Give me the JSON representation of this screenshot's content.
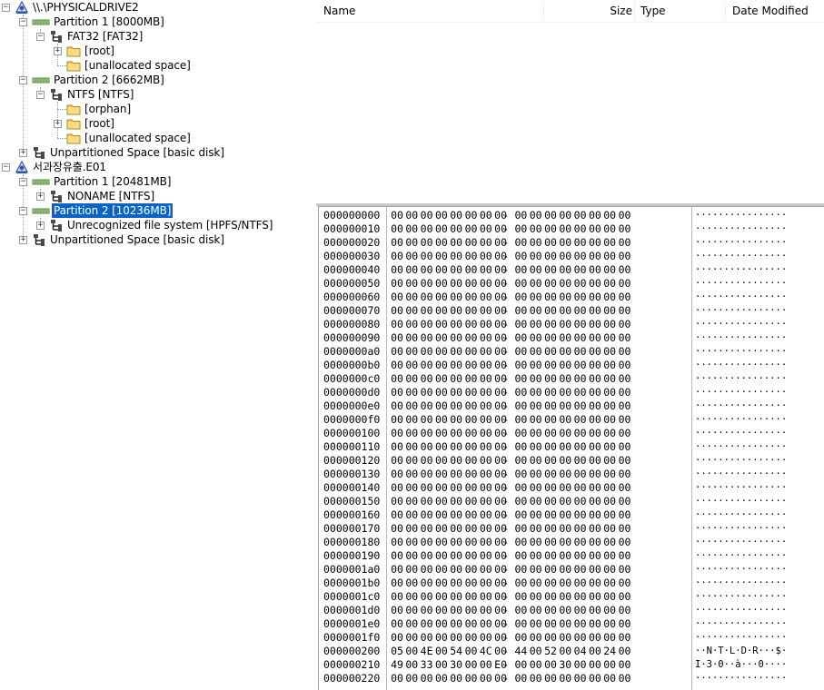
{
  "tree": {
    "nodes": [
      {
        "id": "drive2",
        "depth": 0,
        "label": "\\\\.\\PHYSICALDRIVE2",
        "icon": "disk-icon",
        "expander": "minus",
        "selected": false
      },
      {
        "id": "d2p1",
        "depth": 1,
        "label": "Partition 1 [8000MB]",
        "icon": "partition-icon",
        "expander": "minus",
        "selected": false
      },
      {
        "id": "d2p1fs",
        "depth": 2,
        "label": "FAT32 [FAT32]",
        "icon": "filesystem-icon",
        "expander": "minus",
        "selected": false
      },
      {
        "id": "d2p1root",
        "depth": 3,
        "label": "[root]",
        "icon": "folder-icon",
        "expander": "plus",
        "selected": false
      },
      {
        "id": "d2p1un",
        "depth": 3,
        "label": "[unallocated space]",
        "icon": "folder-icon",
        "expander": "none",
        "selected": false
      },
      {
        "id": "d2p2",
        "depth": 1,
        "label": "Partition 2 [6662MB]",
        "icon": "partition-icon",
        "expander": "minus",
        "selected": false
      },
      {
        "id": "d2p2fs",
        "depth": 2,
        "label": "NTFS [NTFS]",
        "icon": "filesystem-icon",
        "expander": "minus",
        "selected": false
      },
      {
        "id": "d2p2orphan",
        "depth": 3,
        "label": "[orphan]",
        "icon": "folder-icon",
        "expander": "none",
        "selected": false
      },
      {
        "id": "d2p2root",
        "depth": 3,
        "label": "[root]",
        "icon": "folder-icon",
        "expander": "plus",
        "selected": false
      },
      {
        "id": "d2p2un",
        "depth": 3,
        "label": "[unallocated space]",
        "icon": "folder-icon",
        "expander": "none",
        "selected": false
      },
      {
        "id": "d2unp",
        "depth": 1,
        "label": "Unpartitioned Space [basic disk]",
        "icon": "filesystem-icon",
        "expander": "plus",
        "selected": false
      },
      {
        "id": "e01",
        "depth": 0,
        "label": "서과장유출.E01",
        "icon": "disk-icon",
        "expander": "minus",
        "selected": false
      },
      {
        "id": "e01p1",
        "depth": 1,
        "label": "Partition 1 [20481MB]",
        "icon": "partition-icon",
        "expander": "minus",
        "selected": false
      },
      {
        "id": "e01p1fs",
        "depth": 2,
        "label": "NONAME [NTFS]",
        "icon": "filesystem-icon",
        "expander": "plus",
        "selected": false
      },
      {
        "id": "e01p2",
        "depth": 1,
        "label": "Partition 2 [10236MB]",
        "icon": "partition-icon",
        "expander": "minus",
        "selected": true
      },
      {
        "id": "e01p2fs",
        "depth": 2,
        "label": "Unrecognized file system [HPFS/NTFS]",
        "icon": "filesystem-icon",
        "expander": "plus",
        "selected": false
      },
      {
        "id": "e01unp",
        "depth": 1,
        "label": "Unpartitioned Space [basic disk]",
        "icon": "filesystem-icon",
        "expander": "plus",
        "selected": false
      }
    ]
  },
  "file_list": {
    "columns": [
      {
        "key": "name",
        "label": "Name"
      },
      {
        "key": "size",
        "label": "Size"
      },
      {
        "key": "type",
        "label": "Type"
      },
      {
        "key": "date",
        "label": "Date Modified"
      }
    ]
  },
  "hex_view": {
    "rows": [
      {
        "offset": "000000000",
        "bytes": [
          "00",
          "00",
          "00",
          "00",
          "00",
          "00",
          "00",
          "00",
          "00",
          "00",
          "00",
          "00",
          "00",
          "00",
          "00",
          "00"
        ],
        "ascii": "················"
      },
      {
        "offset": "000000010",
        "bytes": [
          "00",
          "00",
          "00",
          "00",
          "00",
          "00",
          "00",
          "00",
          "00",
          "00",
          "00",
          "00",
          "00",
          "00",
          "00",
          "00"
        ],
        "ascii": "················"
      },
      {
        "offset": "000000020",
        "bytes": [
          "00",
          "00",
          "00",
          "00",
          "00",
          "00",
          "00",
          "00",
          "00",
          "00",
          "00",
          "00",
          "00",
          "00",
          "00",
          "00"
        ],
        "ascii": "················"
      },
      {
        "offset": "000000030",
        "bytes": [
          "00",
          "00",
          "00",
          "00",
          "00",
          "00",
          "00",
          "00",
          "00",
          "00",
          "00",
          "00",
          "00",
          "00",
          "00",
          "00"
        ],
        "ascii": "················"
      },
      {
        "offset": "000000040",
        "bytes": [
          "00",
          "00",
          "00",
          "00",
          "00",
          "00",
          "00",
          "00",
          "00",
          "00",
          "00",
          "00",
          "00",
          "00",
          "00",
          "00"
        ],
        "ascii": "················"
      },
      {
        "offset": "000000050",
        "bytes": [
          "00",
          "00",
          "00",
          "00",
          "00",
          "00",
          "00",
          "00",
          "00",
          "00",
          "00",
          "00",
          "00",
          "00",
          "00",
          "00"
        ],
        "ascii": "················"
      },
      {
        "offset": "000000060",
        "bytes": [
          "00",
          "00",
          "00",
          "00",
          "00",
          "00",
          "00",
          "00",
          "00",
          "00",
          "00",
          "00",
          "00",
          "00",
          "00",
          "00"
        ],
        "ascii": "················"
      },
      {
        "offset": "000000070",
        "bytes": [
          "00",
          "00",
          "00",
          "00",
          "00",
          "00",
          "00",
          "00",
          "00",
          "00",
          "00",
          "00",
          "00",
          "00",
          "00",
          "00"
        ],
        "ascii": "················"
      },
      {
        "offset": "000000080",
        "bytes": [
          "00",
          "00",
          "00",
          "00",
          "00",
          "00",
          "00",
          "00",
          "00",
          "00",
          "00",
          "00",
          "00",
          "00",
          "00",
          "00"
        ],
        "ascii": "················"
      },
      {
        "offset": "000000090",
        "bytes": [
          "00",
          "00",
          "00",
          "00",
          "00",
          "00",
          "00",
          "00",
          "00",
          "00",
          "00",
          "00",
          "00",
          "00",
          "00",
          "00"
        ],
        "ascii": "················"
      },
      {
        "offset": "0000000a0",
        "bytes": [
          "00",
          "00",
          "00",
          "00",
          "00",
          "00",
          "00",
          "00",
          "00",
          "00",
          "00",
          "00",
          "00",
          "00",
          "00",
          "00"
        ],
        "ascii": "················"
      },
      {
        "offset": "0000000b0",
        "bytes": [
          "00",
          "00",
          "00",
          "00",
          "00",
          "00",
          "00",
          "00",
          "00",
          "00",
          "00",
          "00",
          "00",
          "00",
          "00",
          "00"
        ],
        "ascii": "················"
      },
      {
        "offset": "0000000c0",
        "bytes": [
          "00",
          "00",
          "00",
          "00",
          "00",
          "00",
          "00",
          "00",
          "00",
          "00",
          "00",
          "00",
          "00",
          "00",
          "00",
          "00"
        ],
        "ascii": "················"
      },
      {
        "offset": "0000000d0",
        "bytes": [
          "00",
          "00",
          "00",
          "00",
          "00",
          "00",
          "00",
          "00",
          "00",
          "00",
          "00",
          "00",
          "00",
          "00",
          "00",
          "00"
        ],
        "ascii": "················"
      },
      {
        "offset": "0000000e0",
        "bytes": [
          "00",
          "00",
          "00",
          "00",
          "00",
          "00",
          "00",
          "00",
          "00",
          "00",
          "00",
          "00",
          "00",
          "00",
          "00",
          "00"
        ],
        "ascii": "················"
      },
      {
        "offset": "0000000f0",
        "bytes": [
          "00",
          "00",
          "00",
          "00",
          "00",
          "00",
          "00",
          "00",
          "00",
          "00",
          "00",
          "00",
          "00",
          "00",
          "00",
          "00"
        ],
        "ascii": "················"
      },
      {
        "offset": "000000100",
        "bytes": [
          "00",
          "00",
          "00",
          "00",
          "00",
          "00",
          "00",
          "00",
          "00",
          "00",
          "00",
          "00",
          "00",
          "00",
          "00",
          "00"
        ],
        "ascii": "················"
      },
      {
        "offset": "000000110",
        "bytes": [
          "00",
          "00",
          "00",
          "00",
          "00",
          "00",
          "00",
          "00",
          "00",
          "00",
          "00",
          "00",
          "00",
          "00",
          "00",
          "00"
        ],
        "ascii": "················"
      },
      {
        "offset": "000000120",
        "bytes": [
          "00",
          "00",
          "00",
          "00",
          "00",
          "00",
          "00",
          "00",
          "00",
          "00",
          "00",
          "00",
          "00",
          "00",
          "00",
          "00"
        ],
        "ascii": "················"
      },
      {
        "offset": "000000130",
        "bytes": [
          "00",
          "00",
          "00",
          "00",
          "00",
          "00",
          "00",
          "00",
          "00",
          "00",
          "00",
          "00",
          "00",
          "00",
          "00",
          "00"
        ],
        "ascii": "················"
      },
      {
        "offset": "000000140",
        "bytes": [
          "00",
          "00",
          "00",
          "00",
          "00",
          "00",
          "00",
          "00",
          "00",
          "00",
          "00",
          "00",
          "00",
          "00",
          "00",
          "00"
        ],
        "ascii": "················"
      },
      {
        "offset": "000000150",
        "bytes": [
          "00",
          "00",
          "00",
          "00",
          "00",
          "00",
          "00",
          "00",
          "00",
          "00",
          "00",
          "00",
          "00",
          "00",
          "00",
          "00"
        ],
        "ascii": "················"
      },
      {
        "offset": "000000160",
        "bytes": [
          "00",
          "00",
          "00",
          "00",
          "00",
          "00",
          "00",
          "00",
          "00",
          "00",
          "00",
          "00",
          "00",
          "00",
          "00",
          "00"
        ],
        "ascii": "················"
      },
      {
        "offset": "000000170",
        "bytes": [
          "00",
          "00",
          "00",
          "00",
          "00",
          "00",
          "00",
          "00",
          "00",
          "00",
          "00",
          "00",
          "00",
          "00",
          "00",
          "00"
        ],
        "ascii": "················"
      },
      {
        "offset": "000000180",
        "bytes": [
          "00",
          "00",
          "00",
          "00",
          "00",
          "00",
          "00",
          "00",
          "00",
          "00",
          "00",
          "00",
          "00",
          "00",
          "00",
          "00"
        ],
        "ascii": "················"
      },
      {
        "offset": "000000190",
        "bytes": [
          "00",
          "00",
          "00",
          "00",
          "00",
          "00",
          "00",
          "00",
          "00",
          "00",
          "00",
          "00",
          "00",
          "00",
          "00",
          "00"
        ],
        "ascii": "················"
      },
      {
        "offset": "0000001a0",
        "bytes": [
          "00",
          "00",
          "00",
          "00",
          "00",
          "00",
          "00",
          "00",
          "00",
          "00",
          "00",
          "00",
          "00",
          "00",
          "00",
          "00"
        ],
        "ascii": "················"
      },
      {
        "offset": "0000001b0",
        "bytes": [
          "00",
          "00",
          "00",
          "00",
          "00",
          "00",
          "00",
          "00",
          "00",
          "00",
          "00",
          "00",
          "00",
          "00",
          "00",
          "00"
        ],
        "ascii": "················"
      },
      {
        "offset": "0000001c0",
        "bytes": [
          "00",
          "00",
          "00",
          "00",
          "00",
          "00",
          "00",
          "00",
          "00",
          "00",
          "00",
          "00",
          "00",
          "00",
          "00",
          "00"
        ],
        "ascii": "················"
      },
      {
        "offset": "0000001d0",
        "bytes": [
          "00",
          "00",
          "00",
          "00",
          "00",
          "00",
          "00",
          "00",
          "00",
          "00",
          "00",
          "00",
          "00",
          "00",
          "00",
          "00"
        ],
        "ascii": "················"
      },
      {
        "offset": "0000001e0",
        "bytes": [
          "00",
          "00",
          "00",
          "00",
          "00",
          "00",
          "00",
          "00",
          "00",
          "00",
          "00",
          "00",
          "00",
          "00",
          "00",
          "00"
        ],
        "ascii": "················"
      },
      {
        "offset": "0000001f0",
        "bytes": [
          "00",
          "00",
          "00",
          "00",
          "00",
          "00",
          "00",
          "00",
          "00",
          "00",
          "00",
          "00",
          "00",
          "00",
          "00",
          "00"
        ],
        "ascii": "················"
      },
      {
        "offset": "000000200",
        "bytes": [
          "05",
          "00",
          "4E",
          "00",
          "54",
          "00",
          "4C",
          "00",
          "44",
          "00",
          "52",
          "00",
          "04",
          "00",
          "24",
          "00"
        ],
        "ascii": "··N·T·L·D·R···$·"
      },
      {
        "offset": "000000210",
        "bytes": [
          "49",
          "00",
          "33",
          "00",
          "30",
          "00",
          "00",
          "E0",
          "00",
          "00",
          "00",
          "30",
          "00",
          "00",
          "00",
          "00"
        ],
        "ascii": "I·3·0··à···0····"
      },
      {
        "offset": "000000220",
        "bytes": [
          "00",
          "00",
          "00",
          "00",
          "00",
          "00",
          "00",
          "00",
          "00",
          "00",
          "00",
          "00",
          "00",
          "00",
          "00",
          "00"
        ],
        "ascii": "················"
      }
    ]
  },
  "colors": {
    "selection": "#0a64c8",
    "folder": "#f3cf6a",
    "disk": "#2f55a8"
  }
}
